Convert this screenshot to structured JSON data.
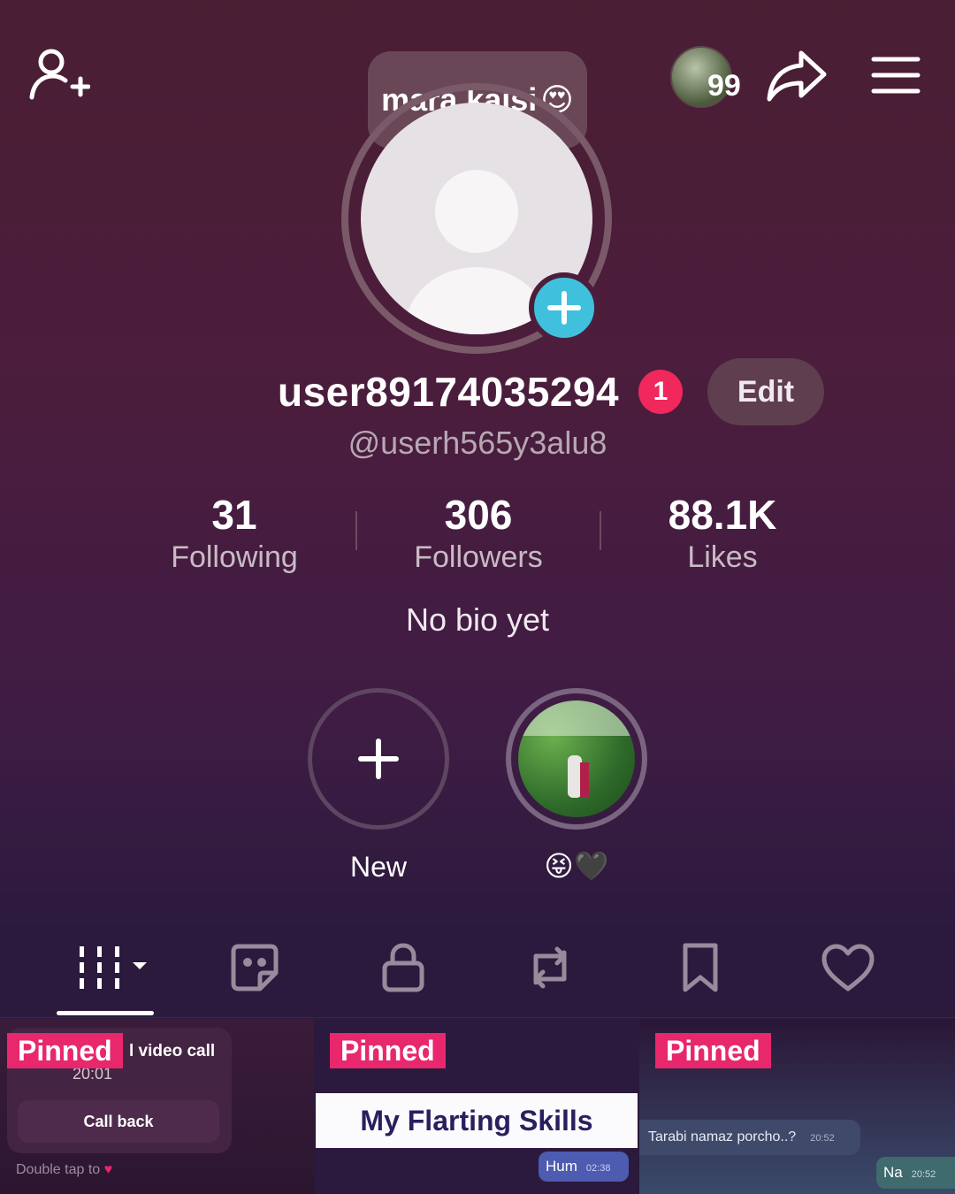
{
  "header": {
    "tooltip_text": "mara kaisi",
    "tooltip_emoji": "😍",
    "views_count": "99"
  },
  "profile": {
    "username": "user89174035294",
    "notification_count": "1",
    "edit_label": "Edit",
    "handle": "@userh565y3alu8",
    "bio": "No bio yet"
  },
  "stats": [
    {
      "value": "31",
      "label": "Following"
    },
    {
      "value": "306",
      "label": "Followers"
    },
    {
      "value": "88.1K",
      "label": "Likes"
    }
  ],
  "highlights": {
    "new_label": "New",
    "story_label": "😝🖤"
  },
  "tabs": [
    "videos-grid-icon",
    "stickers-icon",
    "lock-icon",
    "repost-icon",
    "bookmark-icon",
    "heart-icon"
  ],
  "videos": [
    {
      "pinned_label": "Pinned",
      "title_fragment": "l video call",
      "time": "20:01",
      "button": "Call back",
      "hint": "Double tap to"
    },
    {
      "pinned_label": "Pinned",
      "banner": "My Flarting Skills",
      "bubble": "Hum",
      "bubble_time": "02:38"
    },
    {
      "pinned_label": "Pinned",
      "message": "Tarabi namaz porcho..?",
      "message_time": "20:52",
      "reply": "Na",
      "reply_time": "20:52"
    }
  ],
  "colors": {
    "accent_pink": "#e8276d",
    "badge_red": "#f0285c",
    "add_avatar_blue": "#3fc1dd"
  }
}
